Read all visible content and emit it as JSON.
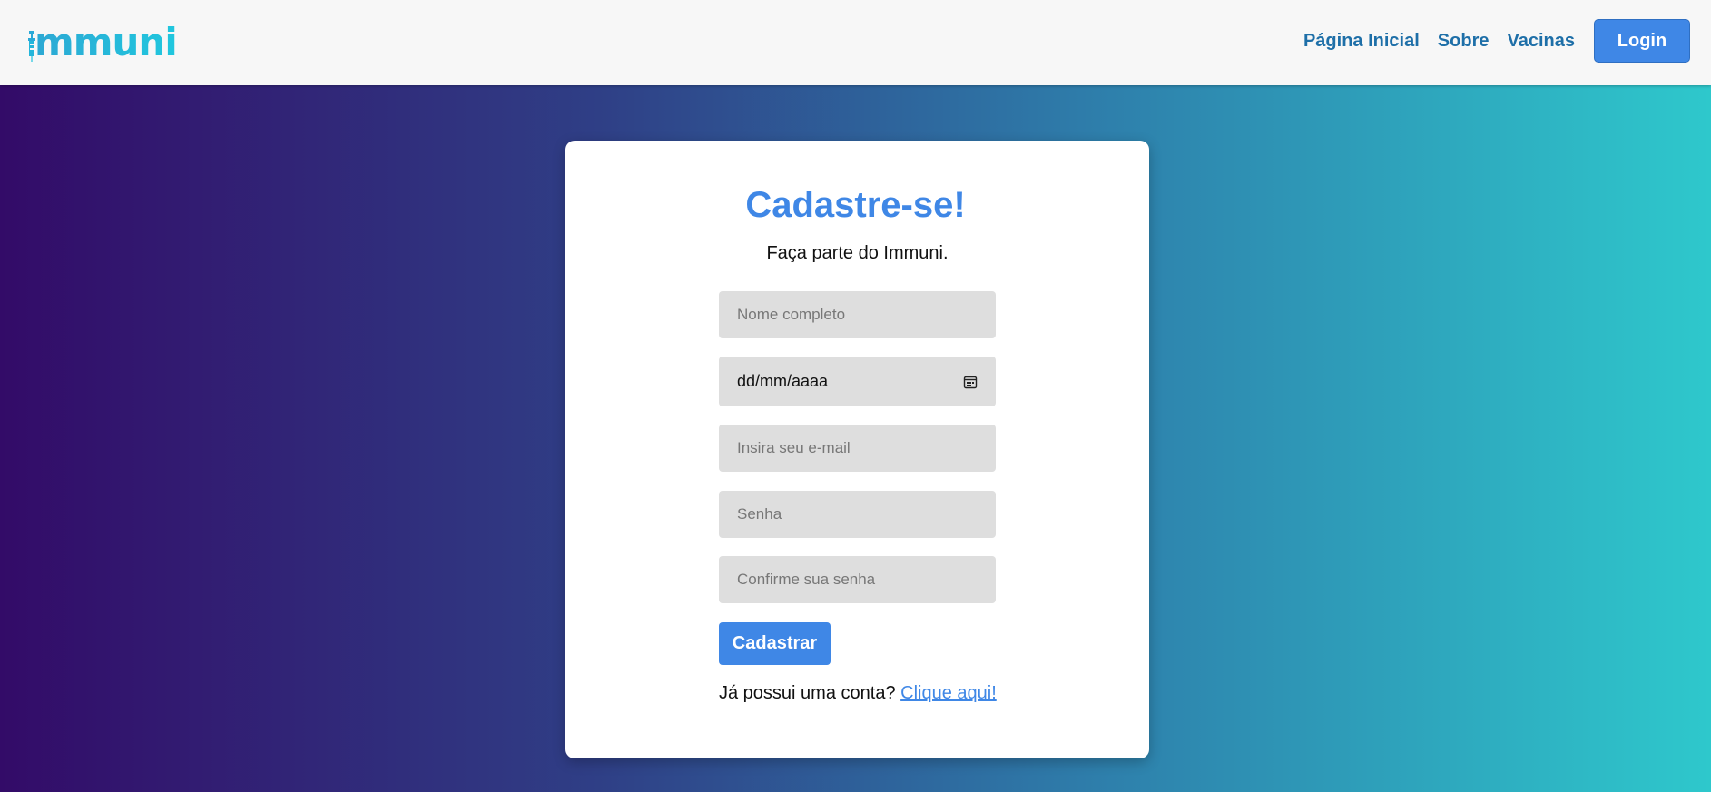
{
  "brand": {
    "name": "mmuni",
    "icon": "syringe-icon",
    "colors": {
      "start": "#2da8d4",
      "end": "#20c7de"
    }
  },
  "nav": {
    "links": [
      "Página Inicial",
      "Sobre",
      "Vacinas"
    ],
    "login_label": "Login"
  },
  "form": {
    "title": "Cadastre-se!",
    "subtitle": "Faça parte do Immuni.",
    "name_placeholder": "Nome completo",
    "date_placeholder": "dd/mm/aaaa",
    "date_icon": "calendar-icon",
    "email_placeholder": "Insira seu e-mail",
    "password_placeholder": "Senha",
    "confirm_placeholder": "Confirme sua senha",
    "submit_label": "Cadastrar",
    "have_account_text": "Já possui uma conta?",
    "login_link_text": "Clique aqui!"
  },
  "colors": {
    "accent": "#3f87e6",
    "nav_link": "#1e6fa8",
    "field_bg": "#dedede",
    "gradient_start": "#330b68",
    "gradient_end": "#2ec8cc"
  }
}
